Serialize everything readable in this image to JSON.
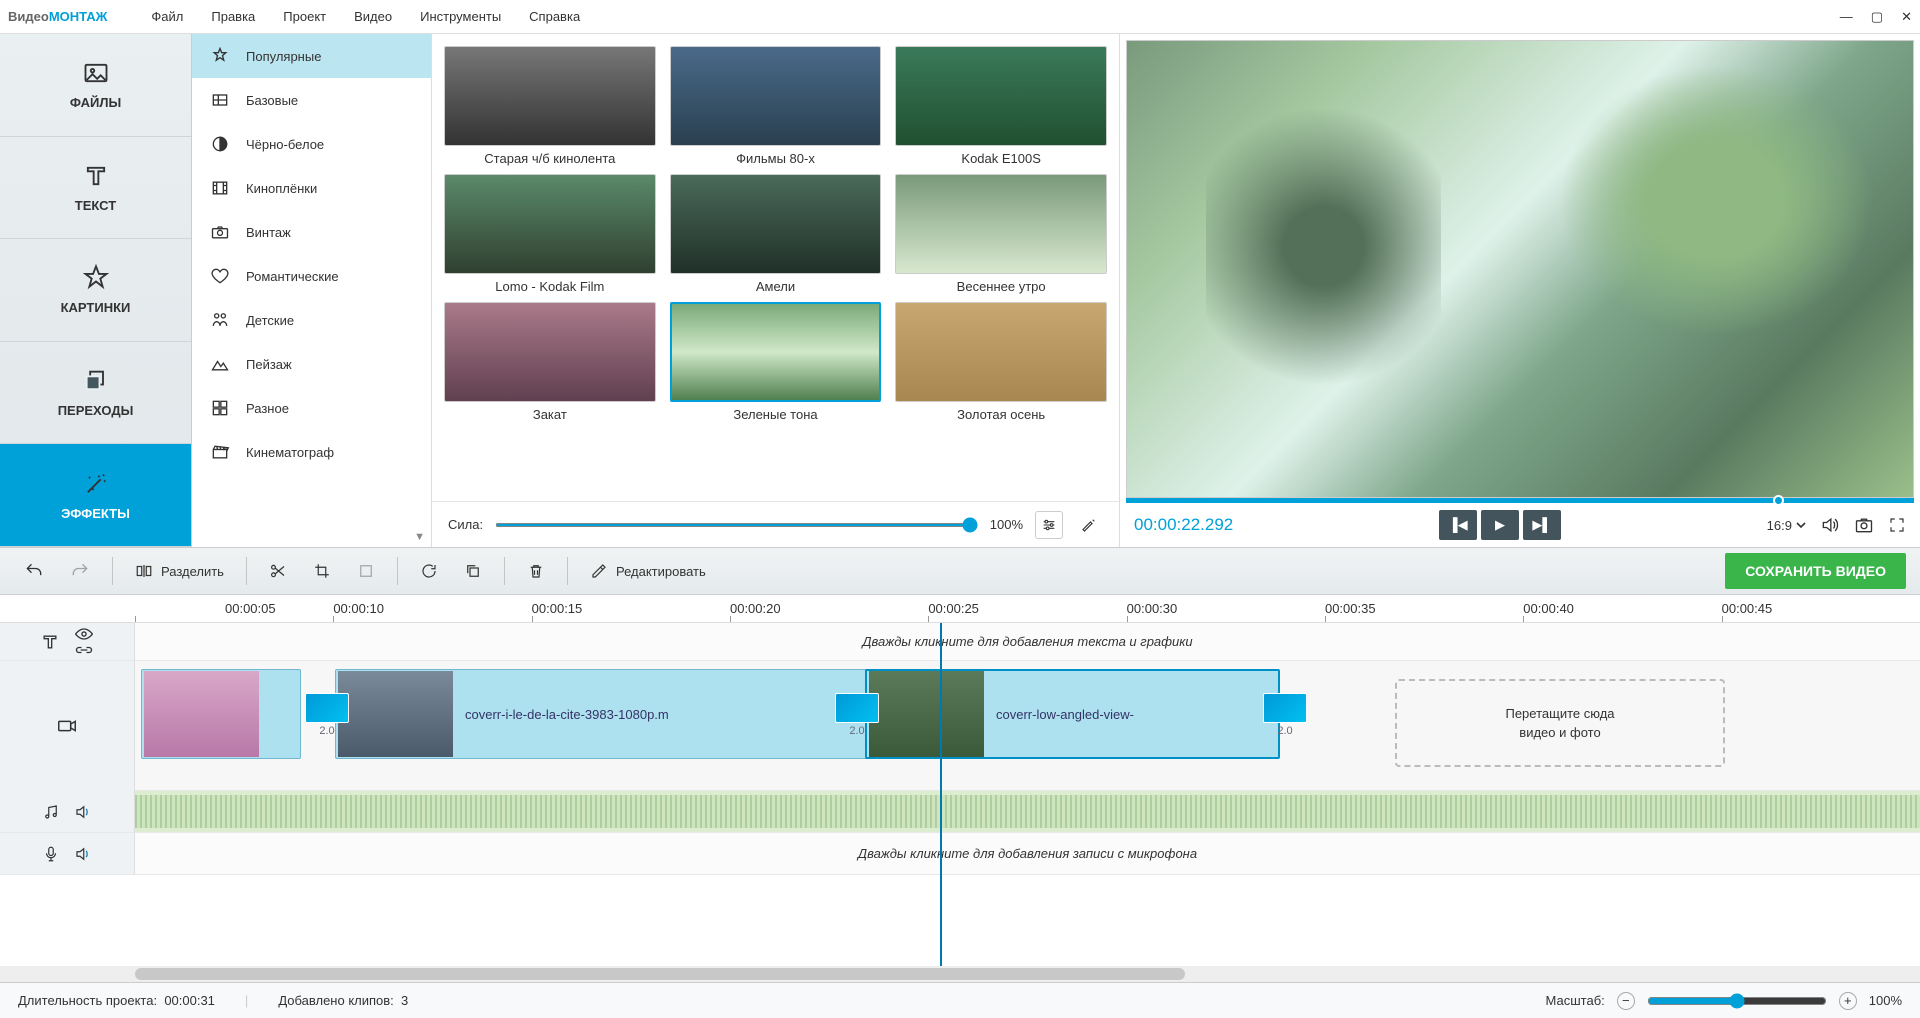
{
  "app": {
    "name1": "Видео",
    "name2": "МОНТАЖ"
  },
  "menu": [
    "Файл",
    "Правка",
    "Проект",
    "Видео",
    "Инструменты",
    "Справка"
  ],
  "leftnav": [
    {
      "label": "ФАЙЛЫ"
    },
    {
      "label": "ТЕКСТ"
    },
    {
      "label": "КАРТИНКИ"
    },
    {
      "label": "ПЕРЕХОДЫ"
    },
    {
      "label": "ЭФФЕКТЫ"
    }
  ],
  "categories": [
    {
      "label": "Популярные",
      "sel": true
    },
    {
      "label": "Базовые"
    },
    {
      "label": "Чёрно-белое"
    },
    {
      "label": "Киноплёнки"
    },
    {
      "label": "Винтаж"
    },
    {
      "label": "Романтические"
    },
    {
      "label": "Детские"
    },
    {
      "label": "Пейзаж"
    },
    {
      "label": "Разное"
    },
    {
      "label": "Кинематограф"
    }
  ],
  "effects": [
    {
      "label": "Старая ч/б кинолента",
      "cls": "t1"
    },
    {
      "label": "Фильмы 80-х",
      "cls": "t2"
    },
    {
      "label": "Kodak E100S",
      "cls": "t3"
    },
    {
      "label": "Lomo - Kodak Film",
      "cls": "t4"
    },
    {
      "label": "Амели",
      "cls": "t5"
    },
    {
      "label": "Весеннее утро",
      "cls": "t6"
    },
    {
      "label": "Закат",
      "cls": "t7"
    },
    {
      "label": "Зеленые тона",
      "cls": "t8",
      "sel": true
    },
    {
      "label": "Золотая осень",
      "cls": "t9"
    }
  ],
  "strength": {
    "label": "Сила:",
    "value": "100%"
  },
  "preview": {
    "time": "00:00:22.292",
    "aspect": "16:9"
  },
  "toolbar": {
    "split": "Разделить",
    "edit": "Редактировать",
    "save": "СОХРАНИТЬ ВИДЕО"
  },
  "ruler": [
    "00:00:05",
    "00:00:10",
    "00:00:15",
    "00:00:20",
    "00:00:25",
    "00:00:30",
    "00:00:35",
    "00:00:40",
    "00:00:45"
  ],
  "hints": {
    "text": "Дважды кликните для добавления текста и графики",
    "mic": "Дважды кликните для добавления записи с микрофона",
    "drop": "Перетащите сюда\nвидео и фото"
  },
  "clips": {
    "c1": {
      "name": "coverr-i-le-de-la-cite-3983-1080p.m"
    },
    "c2": {
      "name": "coverr-low-angled-view-"
    }
  },
  "trans": {
    "t": "2.0"
  },
  "status": {
    "dur_l": "Длительность проекта:",
    "dur_v": "00:00:31",
    "clips_l": "Добавлено клипов:",
    "clips_v": "3",
    "zoom_l": "Масштаб:",
    "zoom_v": "100%"
  }
}
